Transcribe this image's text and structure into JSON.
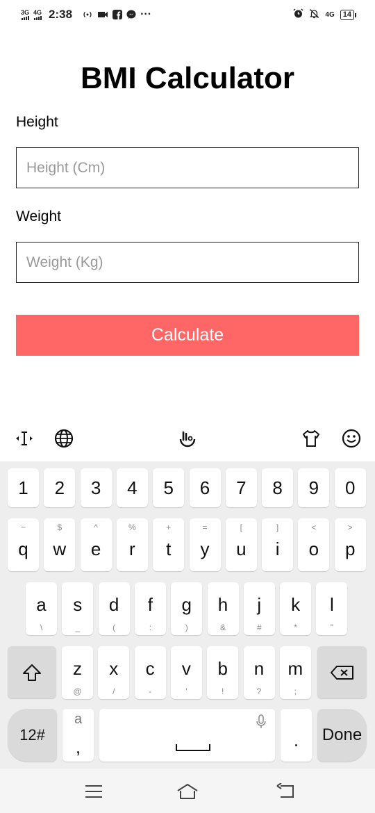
{
  "status_bar": {
    "net1": "3G",
    "net2": "4G",
    "time": "2:38",
    "more": "···",
    "net3": "4G",
    "battery": "14",
    "icons": [
      "signal-icon",
      "hotspot-icon",
      "video-icon",
      "facebook-icon",
      "messenger-icon",
      "alarm-icon",
      "mute-icon",
      "battery-icon"
    ]
  },
  "app": {
    "title": "BMI Calculator",
    "height_label": "Height",
    "height_placeholder": "Height (Cm)",
    "height_value": "",
    "weight_label": "Weight",
    "weight_placeholder": "Weight (Kg)",
    "weight_value": "",
    "calculate_label": "Calculate",
    "accent_color": "#ff6666"
  },
  "keyboard": {
    "toolbar_icons": [
      "cursor-icon",
      "globe-icon",
      "touchpal-icon",
      "theme-shirt-icon",
      "emoji-icon"
    ],
    "numbers": [
      "1",
      "2",
      "3",
      "4",
      "5",
      "6",
      "7",
      "8",
      "9",
      "0"
    ],
    "row1": [
      {
        "k": "q",
        "h": "~"
      },
      {
        "k": "w",
        "h": "$"
      },
      {
        "k": "e",
        "h": "^"
      },
      {
        "k": "r",
        "h": "%"
      },
      {
        "k": "t",
        "h": "+"
      },
      {
        "k": "y",
        "h": "="
      },
      {
        "k": "u",
        "h": "["
      },
      {
        "k": "i",
        "h": "]"
      },
      {
        "k": "o",
        "h": "<"
      },
      {
        "k": "p",
        "h": ">"
      }
    ],
    "row2": [
      {
        "k": "a",
        "h": "\\"
      },
      {
        "k": "s",
        "h": "_"
      },
      {
        "k": "d",
        "h": "("
      },
      {
        "k": "f",
        "h": ":"
      },
      {
        "k": "g",
        "h": ")"
      },
      {
        "k": "h",
        "h": "&"
      },
      {
        "k": "j",
        "h": "#"
      },
      {
        "k": "k",
        "h": "*"
      },
      {
        "k": "l",
        "h": "\""
      }
    ],
    "row3": [
      {
        "k": "z",
        "h": "@"
      },
      {
        "k": "x",
        "h": "/"
      },
      {
        "k": "c",
        "h": "-"
      },
      {
        "k": "v",
        "h": "'"
      },
      {
        "k": "b",
        "h": "!"
      },
      {
        "k": "n",
        "h": "?"
      },
      {
        "k": "m",
        "h": ";"
      }
    ],
    "symbols_label": "12#",
    "comma_label": ",",
    "comma_hint": "a",
    "period_label": ".",
    "done_label": "Done"
  },
  "nav_bar": {
    "icons": [
      "recents-icon",
      "home-icon",
      "back-icon"
    ]
  }
}
